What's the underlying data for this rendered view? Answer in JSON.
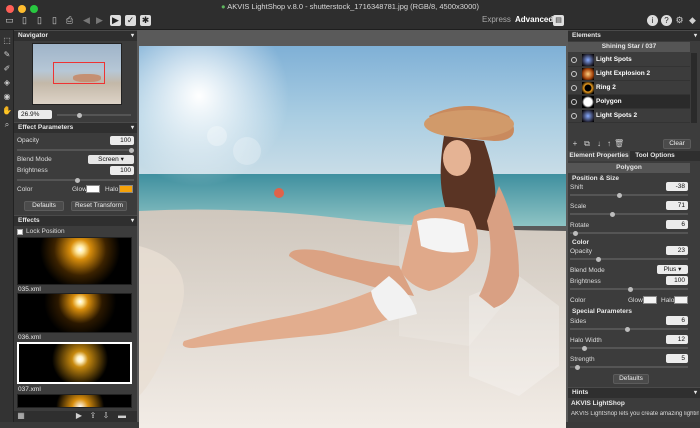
{
  "app": {
    "title": "AKVIS LightShop v.8.0 - shutterstock_1716348781.jpg (RGB/8, 4500x3000)"
  },
  "modes": {
    "express": "Express",
    "advanced": "Advanced"
  },
  "navigator": {
    "header": "Navigator",
    "zoom": "26.9%"
  },
  "effect_params": {
    "header": "Effect Parameters",
    "opacity_label": "Opacity",
    "opacity_value": "100",
    "blend_label": "Blend Mode",
    "blend_value": "Screen",
    "brightness_label": "Brightness",
    "brightness_value": "100",
    "color_label": "Color",
    "glow_label": "Glow",
    "halo_label": "Halo",
    "defaults_label": "Defaults",
    "reset_label": "Reset Transform",
    "glow_color": "#ffffff",
    "halo_color": "#f5a20a"
  },
  "effects": {
    "header": "Effects",
    "lock_label": "Lock Position",
    "items": [
      "035.xml",
      "036.xml",
      "037.xml"
    ]
  },
  "elements": {
    "header": "Elements",
    "preset": "Shining Star / 037",
    "items": [
      "Light Spots",
      "Light Explosion 2",
      "Ring 2",
      "Polygon",
      "Light Spots 2"
    ],
    "clear_label": "Clear"
  },
  "props": {
    "tab_element": "Element Properties",
    "tab_tool": "Tool Options",
    "element_name": "Polygon",
    "pos_size": "Position & Size",
    "shift_label": "Shift",
    "shift_value": "-38",
    "scale_label": "Scale",
    "scale_value": "71",
    "rotate_label": "Rotate",
    "rotate_value": "6",
    "color_section": "Color",
    "opacity_label": "Opacity",
    "opacity_value": "23",
    "blend_label": "Blend Mode",
    "blend_value": "Plus",
    "brightness_label": "Brightness",
    "brightness_value": "100",
    "color_label": "Color",
    "glow_label": "Glow",
    "halo_label": "Halo",
    "special": "Special Parameters",
    "sides_label": "Sides",
    "sides_value": "6",
    "halo_width_label": "Halo Width",
    "halo_width_value": "12",
    "strength_label": "Strength",
    "strength_value": "5",
    "defaults_label": "Defaults"
  },
  "hints": {
    "header": "Hints",
    "title": "AKVIS LightShop",
    "text": "AKVIS LightShop lets you create amazing lighting"
  }
}
